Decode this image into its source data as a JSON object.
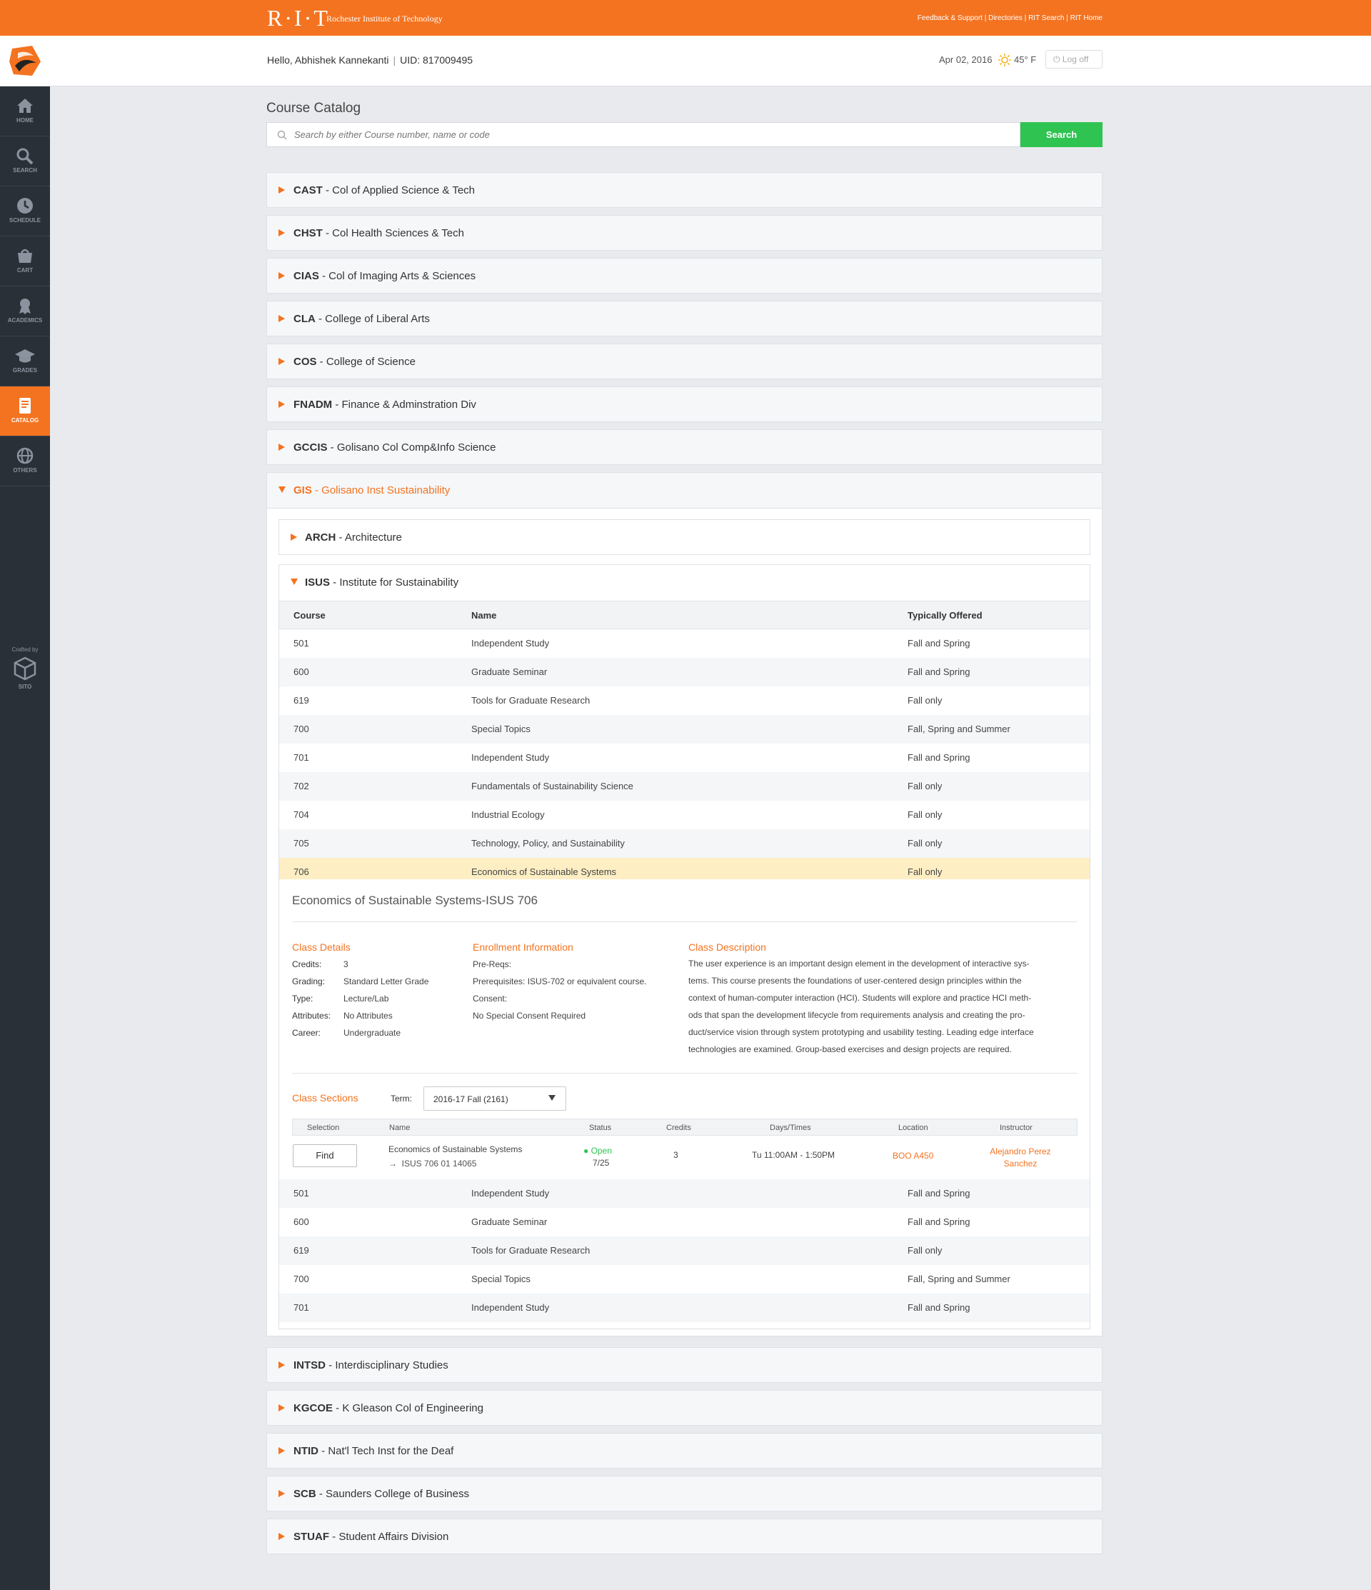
{
  "topbar": {
    "logo": "R·I·T",
    "name": "Rochester Institute of Technology",
    "links": [
      "Feedback & Support",
      "Directories",
      "RIT Search",
      "RIT Home"
    ]
  },
  "sidebar": {
    "items": [
      {
        "label": "Home",
        "icon": "home-icon"
      },
      {
        "label": "Search",
        "icon": "search-icon"
      },
      {
        "label": "Schedule",
        "icon": "clock-icon"
      },
      {
        "label": "Cart",
        "icon": "cart-icon"
      },
      {
        "label": "Academics",
        "icon": "award-icon"
      },
      {
        "label": "Grades",
        "icon": "graduation-cap-icon"
      },
      {
        "label": "Catalog",
        "icon": "book-icon"
      },
      {
        "label": "Others",
        "icon": "globe-icon"
      }
    ],
    "active": "Catalog",
    "crafted_by": "Crafted by",
    "crafted_name": "SITO"
  },
  "header": {
    "greeting": "Hello, Abhishek Kannekanti",
    "uid": "UID: 817009495",
    "date": "Apr 02, 2016",
    "temp": "45° F",
    "logoff": "Log off"
  },
  "catalog": {
    "title": "Course Catalog",
    "search_placeholder": "Search by either Course number, name or code",
    "search_button": "Search"
  },
  "colleges_top": [
    {
      "code": "CAST",
      "name": " -  Col of Applied Science & Tech"
    },
    {
      "code": "CHST",
      "name": " - Col Health Sciences & Tech"
    },
    {
      "code": "CIAS",
      "name": " - Col of Imaging Arts & Sciences"
    },
    {
      "code": "CLA",
      "name": " - College of Liberal Arts"
    },
    {
      "code": "COS",
      "name": " - College of Science"
    },
    {
      "code": "FNADM",
      "name": " - Finance & Adminstration Div"
    },
    {
      "code": "GCCIS",
      "name": " - Golisano Col Comp&Info Science"
    }
  ],
  "gis": {
    "code": "GIS",
    "name": " - Golisano Inst Sustainability"
  },
  "departments": [
    {
      "code": "ARCH",
      "name": " - Architecture"
    },
    {
      "code": "ISUS",
      "name": " - Institute for Sustainability"
    }
  ],
  "table": {
    "headers": [
      "Course",
      "Name",
      "Typically Offered"
    ],
    "rows": [
      [
        "501",
        "Independent Study",
        "Fall and Spring"
      ],
      [
        "600",
        "Graduate Seminar",
        "Fall and Spring"
      ],
      [
        "619",
        "Tools for Graduate Research",
        "Fall only"
      ],
      [
        "700",
        "Special Topics",
        "Fall, Spring and Summer"
      ],
      [
        "701",
        "Independent Study",
        "Fall and Spring"
      ],
      [
        "702",
        "Fundamentals of Sustainability Science",
        "Fall only"
      ],
      [
        "704",
        "Industrial Ecology",
        "Fall only"
      ],
      [
        "705",
        "Technology, Policy, and Sustainability",
        "Fall only"
      ],
      [
        "706",
        "Economics of Sustainable Systems",
        "Fall only"
      ]
    ],
    "rows_after": [
      [
        "501",
        "Independent Study",
        "Fall and Spring"
      ],
      [
        "600",
        "Graduate Seminar",
        "Fall and Spring"
      ],
      [
        "619",
        "Tools for Graduate Research",
        "Fall only"
      ],
      [
        "700",
        "Special Topics",
        "Fall, Spring and Summer"
      ],
      [
        "701",
        "Independent Study",
        "Fall and Spring"
      ]
    ]
  },
  "detail": {
    "title": "Economics of Sustainable Systems-ISUS 706",
    "class_details": {
      "heading": "Class Details",
      "items": [
        [
          "Credits:",
          "3"
        ],
        [
          "Grading:",
          "Standard Letter Grade"
        ],
        [
          "Type:",
          "Lecture/Lab"
        ],
        [
          "Attributes:",
          "No Attributes"
        ],
        [
          "Career:",
          "Undergraduate"
        ]
      ]
    },
    "enrollment": {
      "heading": "Enrollment Information",
      "prereq_label": "Pre-Reqs:",
      "prereq": "Prerequisites: ISUS-702 or equivalent course.",
      "consent_label": "Consent:",
      "consent": "No Special Consent Required"
    },
    "description": {
      "heading": "Class Description",
      "lines": [
        "The user experience is an important design element in the development of interactive sys-",
        "tems. This course presents the foundations of user-centered design principles within the",
        "context of human-computer interaction (HCI). Students will explore and practice HCI meth-",
        "ods that span the development lifecycle from requirements analysis and creating the pro-",
        "duct/service vision through system prototyping and usability testing. Leading edge interface",
        "technologies are examined. Group-based exercises and design projects are required."
      ]
    },
    "sections": {
      "heading": "Class Sections",
      "term_label": "Term:",
      "term_value": "2016-17 Fall (2161)",
      "headers": [
        "Selection",
        "Name",
        "Status",
        "Credits",
        "Days/Times",
        "Location",
        "Instructor"
      ],
      "row": {
        "button": "Find",
        "name": "Economics of Sustainable Systems",
        "sub": "ISUS 706 01 14065",
        "status": "Open",
        "seats": "7/25",
        "credits": "3",
        "days": "Tu 11:00AM - 1:50PM",
        "location": "BOO A450",
        "instructor_1": "Alejandro Perez",
        "instructor_2": "Sanchez"
      }
    }
  },
  "colleges_bottom": [
    {
      "code": "INTSD",
      "name": " - Interdisciplinary Studies"
    },
    {
      "code": "KGCOE",
      "name": " - K Gleason Col of Engineering"
    },
    {
      "code": "NTID",
      "name": " - Nat'l Tech Inst for the Deaf"
    },
    {
      "code": "SCB",
      "name": " - Saunders College of Business"
    },
    {
      "code": "STUAF",
      "name": " - Student Affairs Division"
    }
  ],
  "colors": {
    "accent": "#f47320",
    "success": "#2fc351",
    "sidebar": "#2a3038",
    "selected_row": "#fdeec3"
  }
}
